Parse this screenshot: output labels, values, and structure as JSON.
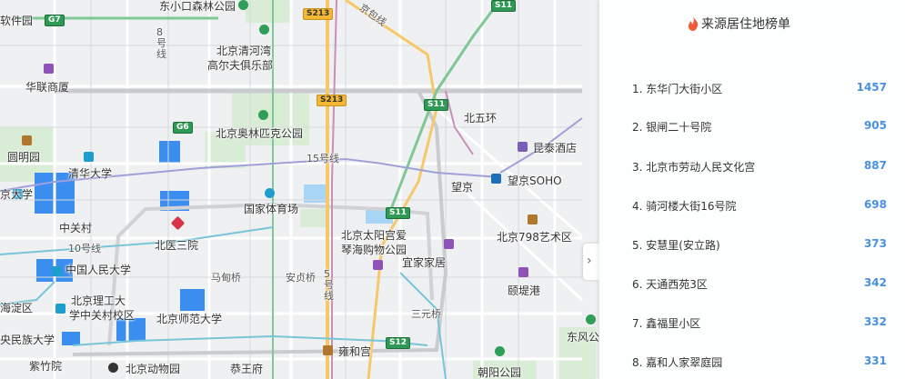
{
  "panel": {
    "title": "来源居住地榜单",
    "items": [
      {
        "rank": "1.",
        "name": "东华门大街小区",
        "count": "1457"
      },
      {
        "rank": "2.",
        "name": "银闸二十号院",
        "count": "905"
      },
      {
        "rank": "3.",
        "name": "北京市劳动人民文化宫",
        "count": "887"
      },
      {
        "rank": "4.",
        "name": "骑河楼大街16号院",
        "count": "698"
      },
      {
        "rank": "5.",
        "name": "安慧里(安立路)",
        "count": "373"
      },
      {
        "rank": "6.",
        "name": "天通西苑3区",
        "count": "342"
      },
      {
        "rank": "7.",
        "name": "鑫福里小区",
        "count": "332"
      },
      {
        "rank": "8.",
        "name": "嘉和人家翠庭园",
        "count": "331"
      }
    ]
  },
  "map": {
    "labels": {
      "ruanjianyuan": "软件园",
      "dongxiaokou": "东小口森林公园",
      "qinghe_golf_1": "北京清河湾",
      "qinghe_golf_2": "高尔夫俱乐部",
      "huayi": "华联商厦",
      "yuanmingyuan": "圆明园",
      "qinghua": "清华大学",
      "aolinpike": "北京奥林匹克公园",
      "beiwuhuan": "北五环",
      "kuntai": "昆泰酒店",
      "wangjing_soho": "望京SOHO",
      "wangjing": "望京",
      "guojia_tiyuchang": "国家体育场",
      "daxue": "京大学",
      "zhongguancun": "中关村",
      "beiyi_sanyuan": "北医三院",
      "taiyanggong_1": "北京太阳宫爱",
      "taiyanggong_2": "琴海购物公园",
      "yijiajiaju": "宜家家居",
      "art798": "北京798艺术区",
      "renmin_daxue": "中国人民大学",
      "madianqiao": "马甸桥",
      "anzhenqiao": "安贞桥",
      "ligong_1": "北京理工大",
      "ligong_2": "学中关村校区",
      "haidian": "海淀区",
      "shifan": "北京师范大学",
      "yiheyuan_gang": "颐堤港",
      "sanyuanqiao": "三元桥",
      "minzu": "央民族大学",
      "zizhuyuan": "紫竹院",
      "dongwuyuan": "北京动物园",
      "yonghegong": "雍和宫",
      "dongfeng": "东风公",
      "chaoyang_park": "朝阳公园",
      "deshengmen": "恭王府",
      "line10": "10号线",
      "line15": "15号线",
      "line5": "5\n号\n线",
      "line8": "8\n号\n线",
      "jingbao": "京包线"
    },
    "shields": {
      "g7": "G7",
      "s213a": "S213",
      "s11a": "S11",
      "g6": "G6",
      "s213b": "S213",
      "s11b": "S11",
      "s11c": "S11",
      "s12": "S12"
    }
  },
  "colors": {
    "accent": "#4a90e2",
    "fire": "#f2593a",
    "campus": "#3b8ef0"
  }
}
